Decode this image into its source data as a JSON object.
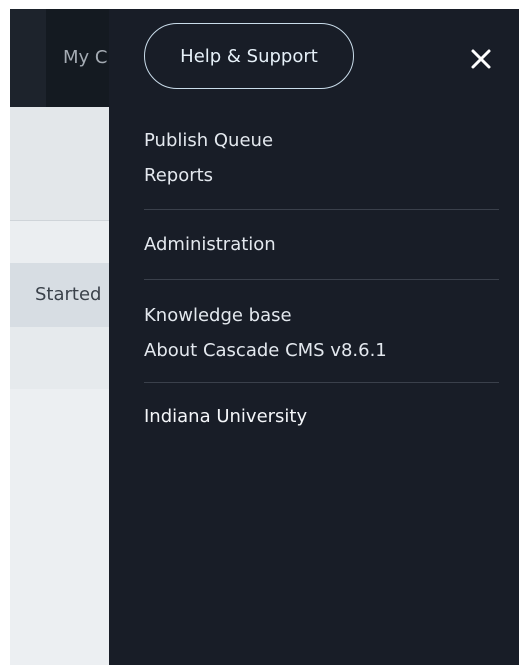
{
  "background": {
    "topbar_item_label": "My C",
    "row_status_label": "Started"
  },
  "menu": {
    "help_button_label": "Help & Support",
    "close_icon": "close-icon",
    "section1": [
      "Publish Queue",
      "Reports"
    ],
    "section2": [
      "Administration"
    ],
    "section3": [
      "Knowledge base",
      "About Cascade CMS v8.6.1"
    ],
    "section4": [
      "Indiana University"
    ]
  },
  "colors": {
    "panel_bg": "#181d27",
    "button_border": "#c9dcea",
    "divider": "#3a404b",
    "text": "#e3e8ee"
  }
}
